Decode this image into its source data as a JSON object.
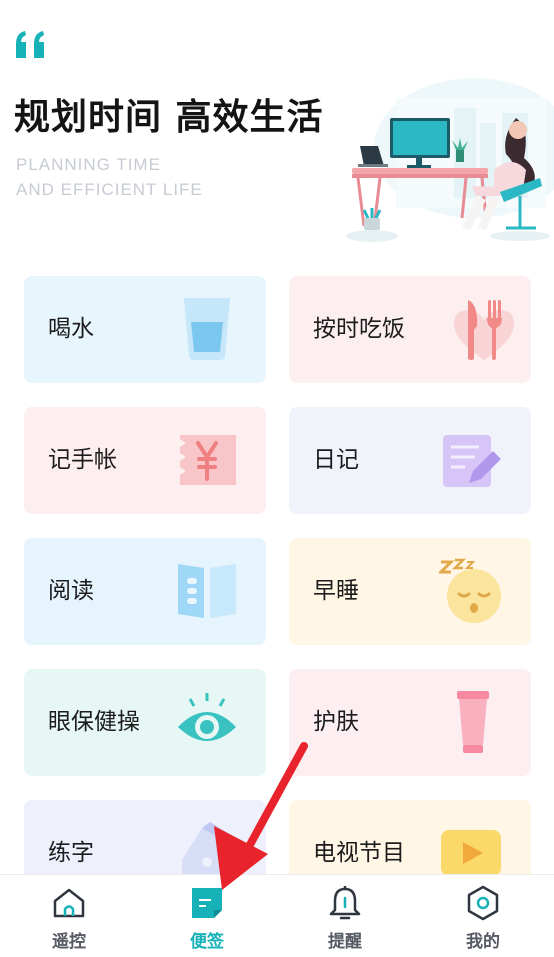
{
  "header": {
    "title": "规划时间 高效生活",
    "subtitle_line1": "PLANNING TIME",
    "subtitle_line2": "AND EFFICIENT LIFE",
    "quote_icon": "quote-icon",
    "illustration": "desk-illustration"
  },
  "cards": [
    {
      "label": "喝水",
      "icon": "water-glass-icon"
    },
    {
      "label": "按时吃饭",
      "icon": "fork-knife-icon"
    },
    {
      "label": "记手帐",
      "icon": "yen-ticket-icon"
    },
    {
      "label": "日记",
      "icon": "notebook-pen-icon"
    },
    {
      "label": "阅读",
      "icon": "book-icon"
    },
    {
      "label": "早睡",
      "icon": "sleeping-face-icon"
    },
    {
      "label": "眼保健操",
      "icon": "eye-icon"
    },
    {
      "label": "护肤",
      "icon": "skincare-tube-icon"
    },
    {
      "label": "练字",
      "icon": "pen-nib-icon"
    },
    {
      "label": "电视节目",
      "icon": "play-icon"
    }
  ],
  "tabbar": {
    "active": "便签",
    "accent_color": "#17b2b8",
    "tabs": [
      {
        "label": "遥控",
        "icon": "home-icon"
      },
      {
        "label": "便签",
        "icon": "note-icon"
      },
      {
        "label": "提醒",
        "icon": "bell-icon"
      },
      {
        "label": "我的",
        "icon": "hexagon-icon"
      }
    ]
  },
  "colors": {
    "title": "#141414",
    "subtitle": "#c7cbd3",
    "arrow": "#e8232b"
  }
}
